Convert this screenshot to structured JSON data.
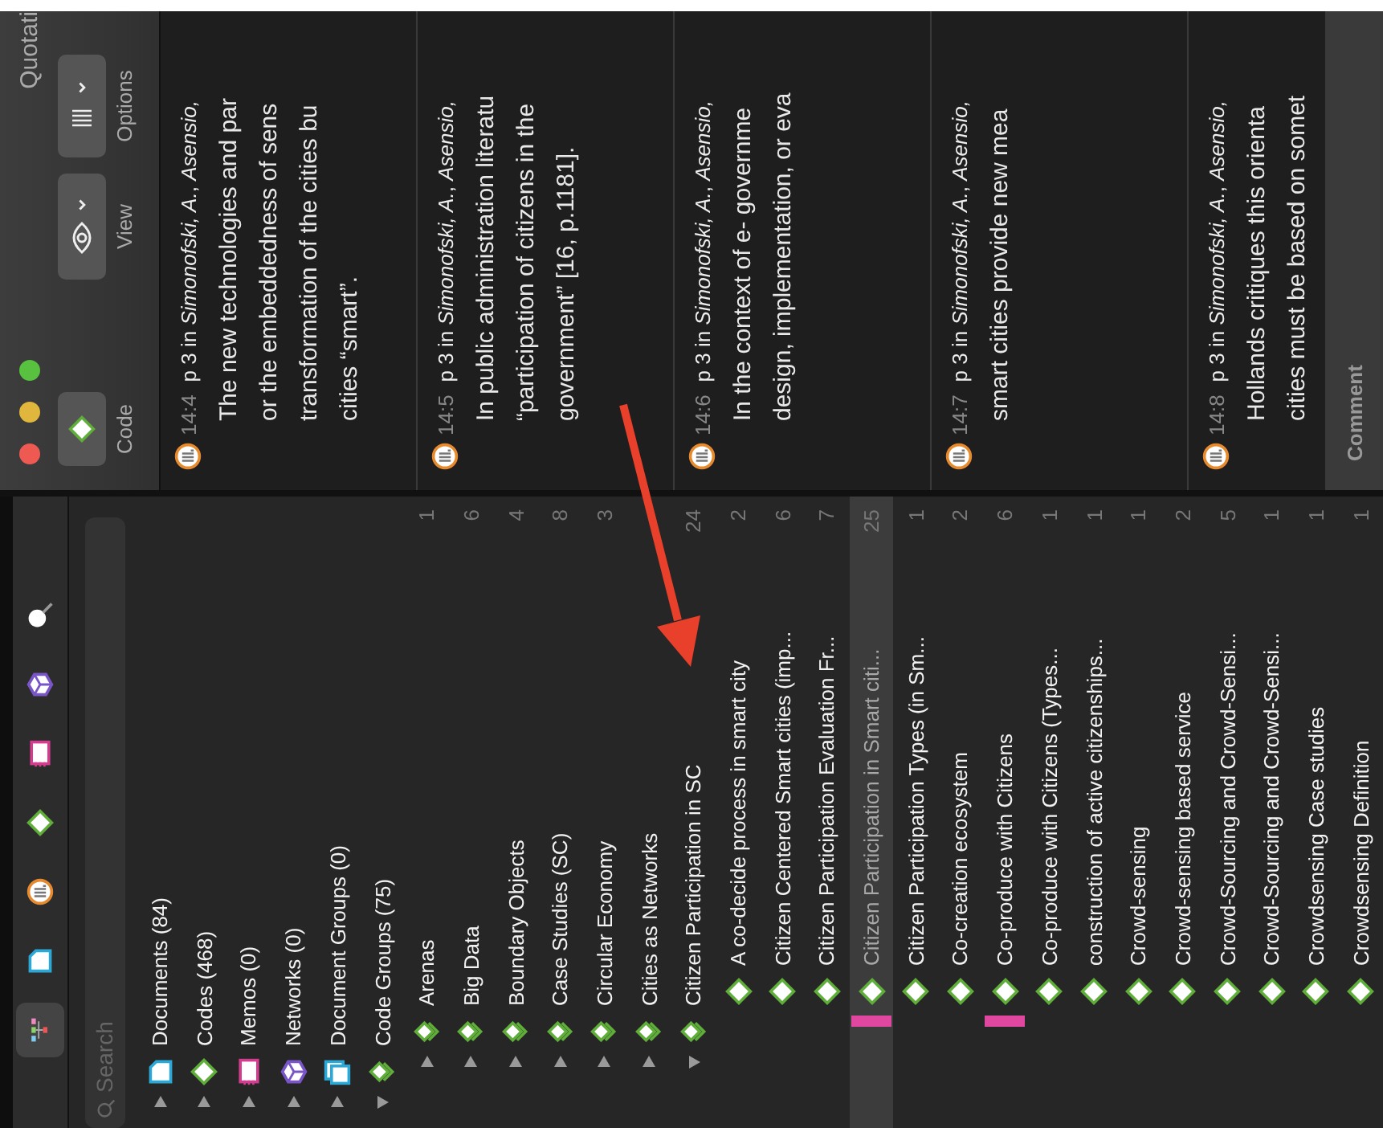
{
  "navigator": {
    "toolbar": [
      {
        "kind": "tree",
        "selected": true
      },
      {
        "kind": "document",
        "selected": false
      },
      {
        "kind": "quotation",
        "selected": false
      },
      {
        "kind": "code",
        "selected": false
      },
      {
        "kind": "memo",
        "selected": false
      },
      {
        "kind": "network",
        "selected": false
      },
      {
        "kind": "search",
        "selected": false
      }
    ],
    "search": {
      "placeholder": "Search"
    },
    "tree": [
      {
        "label": "Documents (84)",
        "kind": "document",
        "expanded": false,
        "selected": false
      },
      {
        "label": "Codes (468)",
        "kind": "code",
        "expanded": false,
        "selected": false
      },
      {
        "label": "Memos (0)",
        "kind": "memo",
        "expanded": false,
        "selected": false
      },
      {
        "label": "Networks (0)",
        "kind": "network",
        "expanded": false,
        "selected": false
      },
      {
        "label": "Document Groups (0)",
        "kind": "document-group",
        "expanded": false,
        "selected": false
      },
      {
        "label": "Code Groups (75)",
        "kind": "code-group",
        "expanded": true,
        "selected": false,
        "children": [
          {
            "label": "Arenas",
            "kind": "code-group",
            "count": "1",
            "expanded": false,
            "selected": false
          },
          {
            "label": "Big Data",
            "kind": "code-group",
            "count": "6",
            "expanded": false,
            "selected": false
          },
          {
            "label": "Boundary Objects",
            "kind": "code-group",
            "count": "4",
            "expanded": false,
            "selected": false
          },
          {
            "label": "Case Studies (SC)",
            "kind": "code-group",
            "count": "8",
            "expanded": false,
            "selected": false
          },
          {
            "label": "Circular Economy",
            "kind": "code-group",
            "count": "3",
            "expanded": false,
            "selected": false
          },
          {
            "label": "Cities as Networks",
            "kind": "code-group",
            "expanded": false,
            "selected": false
          },
          {
            "label": "Citizen Participation in SC",
            "kind": "code-group",
            "count": "24",
            "expanded": true,
            "selected": false,
            "children": [
              {
                "label": "A co-decide process in smart city",
                "kind": "code",
                "count": "2",
                "selected": false,
                "marked": false
              },
              {
                "label": "Citizen Centered Smart cities (imp...",
                "kind": "code",
                "count": "6",
                "selected": false,
                "marked": false
              },
              {
                "label": "Citizen Participation Evaluation Fr...",
                "kind": "code",
                "count": "7",
                "selected": false,
                "marked": false
              },
              {
                "label": "Citizen Participation in Smart citi...",
                "kind": "code",
                "count": "25",
                "selected": true,
                "marked": true
              },
              {
                "label": "Citizen Participation Types (in Sm...",
                "kind": "code",
                "count": "1",
                "selected": false,
                "marked": false
              },
              {
                "label": "Co-creation ecosystem",
                "kind": "code",
                "count": "2",
                "selected": false,
                "marked": false
              },
              {
                "label": "Co-produce with Citizens",
                "kind": "code",
                "count": "6",
                "selected": false,
                "marked": true
              },
              {
                "label": "Co-produce with Citizens (Types...",
                "kind": "code",
                "count": "1",
                "selected": false,
                "marked": false
              },
              {
                "label": "construction of active citizenships...",
                "kind": "code",
                "count": "1",
                "selected": false,
                "marked": false
              },
              {
                "label": "Crowd-sensing",
                "kind": "code",
                "count": "1",
                "selected": false,
                "marked": false
              },
              {
                "label": "Crowd-sensing based service",
                "kind": "code",
                "count": "2",
                "selected": false,
                "marked": false
              },
              {
                "label": "Crowd-Sourcing and Crowd-Sensi...",
                "kind": "code",
                "count": "5",
                "selected": false,
                "marked": false
              },
              {
                "label": "Crowd-Sourcing and Crowd-Sensi...",
                "kind": "code",
                "count": "1",
                "selected": false,
                "marked": false
              },
              {
                "label": "Crowdsensing Case studies",
                "kind": "code",
                "count": "1",
                "selected": false,
                "marked": false
              },
              {
                "label": "Crowdsensing Definition",
                "kind": "code",
                "count": "1",
                "selected": false,
                "marked": false
              }
            ]
          }
        ]
      }
    ]
  },
  "quotations": {
    "title": "Quotati",
    "buttons": [
      {
        "kind": "code",
        "label": "Code"
      },
      {
        "kind": "view",
        "label": "View"
      },
      {
        "kind": "options",
        "label": "Options"
      }
    ],
    "items": [
      {
        "id": "14:4",
        "source": "p 3 in *Simonofski, A.*, *Asensio,*",
        "lines": [
          "The new technologies and par",
          "or the embeddedness of sens",
          "transformation of the cities bu",
          "cities “smart”."
        ]
      },
      {
        "id": "14:5",
        "source": "p 3 in *Simonofski, A.*, *Asensio,*",
        "lines": [
          "In public administration literatu",
          "“participation of citizens in the",
          "government” [16, p.1181]."
        ]
      },
      {
        "id": "14:6",
        "source": "p 3 in *Simonofski, A.*, *Asensio,*",
        "lines": [
          "In the context of e- governme",
          "design, implementation, or eva"
        ]
      },
      {
        "id": "14:7",
        "source": "p 3 in *Simonofski, A.*, *Asensio,*",
        "lines": [
          "smart cities provide new mea"
        ]
      },
      {
        "id": "14:8",
        "source": "p 3 in *Simonofski, A.*, *Asensio,*",
        "lines": [
          "Hollands critiques this orienta",
          "cities must be based on somet"
        ]
      }
    ],
    "comment": {
      "label": "Comment"
    }
  }
}
